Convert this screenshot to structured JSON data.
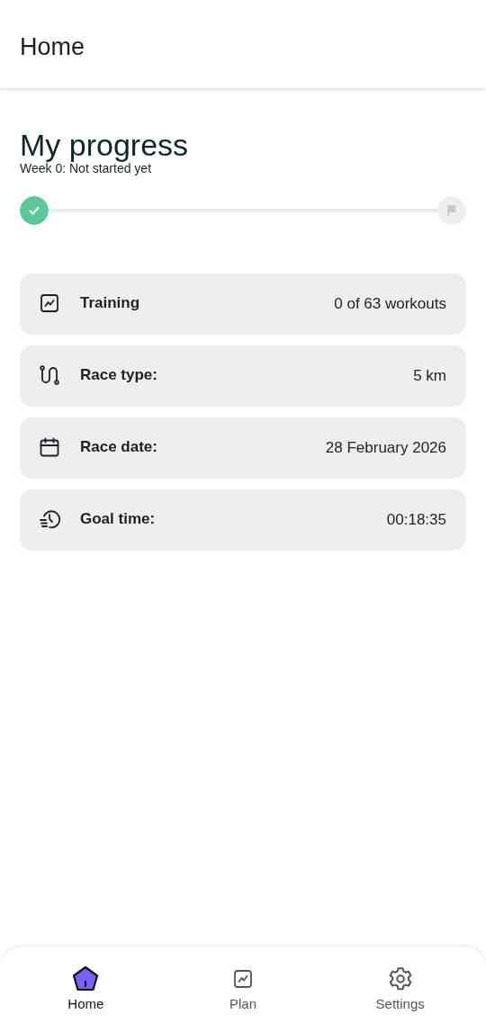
{
  "header": {
    "title": "Home"
  },
  "progress": {
    "title": "My progress",
    "subtitle": "Week 0: Not started yet",
    "start_done": true,
    "finish_done": false
  },
  "cards": [
    {
      "kind": "chart",
      "label": "Training",
      "value": "0 of 63 workouts"
    },
    {
      "kind": "route",
      "label": "Race type:",
      "value": "5 km"
    },
    {
      "kind": "calendar",
      "label": "Race date:",
      "value": "28 February 2026"
    },
    {
      "kind": "clock",
      "label": "Goal time:",
      "value": "00:18:35"
    }
  ],
  "nav": [
    {
      "kind": "home",
      "label": "Home",
      "selected": true
    },
    {
      "kind": "chart",
      "label": "Plan",
      "selected": false
    },
    {
      "kind": "gear",
      "label": "Settings",
      "selected": false
    }
  ]
}
